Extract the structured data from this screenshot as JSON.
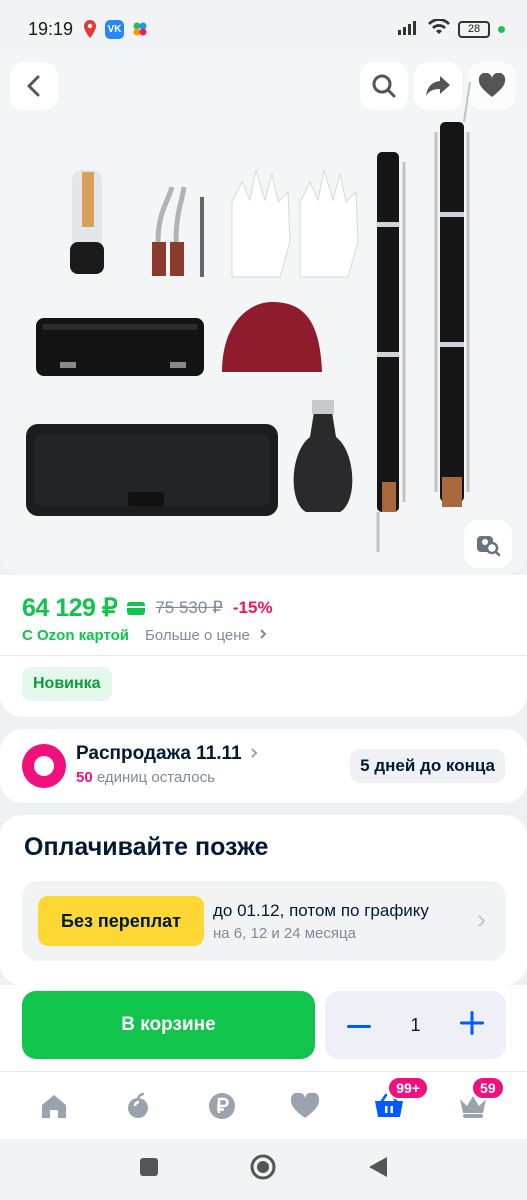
{
  "status_bar": {
    "time": "19:19",
    "battery": "28"
  },
  "product": {
    "price": "64 129 ₽",
    "old_price": "75 530 ₽",
    "discount": "-15%",
    "ozon_card_label": "С Ozon картой",
    "price_more_label": "Больше о цене",
    "badge": "Новинка"
  },
  "sale": {
    "title": "Распродажа 11.11",
    "units_count": "50",
    "units_text": "единиц осталось",
    "days_left": "5 дней до конца"
  },
  "pay_later": {
    "title": "Оплачивайте позже",
    "tag": "Без переплат",
    "line1": "до 01.12, потом по графику",
    "line2": "на 6, 12 и 24 месяца"
  },
  "cart": {
    "button_label": "В корзине",
    "quantity": "1"
  },
  "bottom_nav": {
    "cart_badge": "99+",
    "profile_badge": "59",
    "items": [
      "home-icon",
      "fruit-icon",
      "ruble-icon",
      "heart-icon",
      "cart-icon",
      "crown-icon"
    ]
  },
  "colors": {
    "accent_green": "#10c44c",
    "sale_pink": "#f1117e",
    "discount_red": "#f91155",
    "tag_yellow": "#fdd835"
  }
}
